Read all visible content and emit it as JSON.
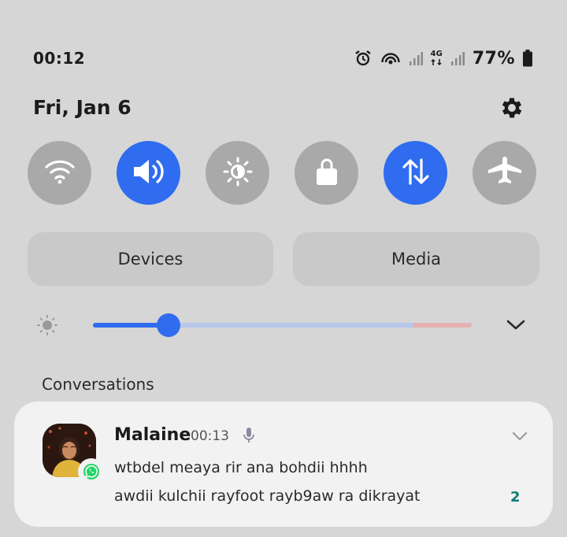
{
  "status_bar": {
    "time": "00:12",
    "network_label": "4G",
    "battery_percent": "77%",
    "icons": [
      "alarm-icon",
      "hotspot-icon",
      "signal-icon",
      "network-4g-icon",
      "signal-icon",
      "battery-icon"
    ]
  },
  "header": {
    "date": "Fri, Jan 6",
    "settings_icon": "gear-icon"
  },
  "quick_toggles": [
    {
      "name": "wifi",
      "icon": "wifi-icon",
      "active": false
    },
    {
      "name": "sound",
      "icon": "volume-icon",
      "active": true
    },
    {
      "name": "eye-comfort",
      "icon": "sun-icon",
      "active": false
    },
    {
      "name": "screen-lock",
      "icon": "lock-icon",
      "active": false
    },
    {
      "name": "mobile-data",
      "icon": "data-arrows-icon",
      "active": true
    },
    {
      "name": "airplane-mode",
      "icon": "airplane-icon",
      "active": false
    }
  ],
  "buttons": {
    "devices": "Devices",
    "media": "Media"
  },
  "brightness": {
    "level": 0.2
  },
  "colors": {
    "accent": "#2f6cf0",
    "inactive_toggle": "#a9a9a9",
    "background": "#d6d6d6",
    "card": "#f2f2f2",
    "count": "#147a72",
    "whatsapp": "#25d366"
  },
  "conversations": {
    "title": "Conversations",
    "notification": {
      "sender": "Malaine",
      "time": "00:13",
      "line1": "wtbdel meaya rir ana bohdii hhhh",
      "line2": "awdii kulchii rayfoot rayb9aw ra dikrayat",
      "count": "2",
      "app_icon": "whatsapp-icon"
    }
  }
}
